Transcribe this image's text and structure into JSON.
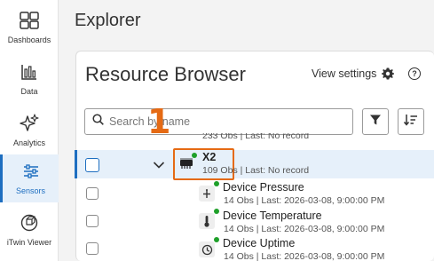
{
  "sidebar": {
    "items": [
      {
        "label": "Dashboards",
        "icon": "dashboards-icon"
      },
      {
        "label": "Data",
        "icon": "data-icon"
      },
      {
        "label": "Analytics",
        "icon": "analytics-icon"
      },
      {
        "label": "Sensors",
        "icon": "sensors-icon",
        "active": true
      },
      {
        "label": "iTwin Viewer",
        "icon": "itwin-viewer-icon"
      }
    ]
  },
  "page": {
    "title": "Explorer"
  },
  "panel": {
    "title": "Resource Browser",
    "view_settings_label": "View settings",
    "help_label": "?"
  },
  "search": {
    "placeholder": "Search by name"
  },
  "step_marker": "1",
  "tree": {
    "partial_row_meta": "233 Obs | Last: No record",
    "selected_node": {
      "name": "X2",
      "meta": "109 Obs | Last: No record"
    },
    "children": [
      {
        "name": "Device Pressure",
        "meta": "14 Obs | Last: 2026-03-08, 9:00:00 PM",
        "icon": "pressure-icon"
      },
      {
        "name": "Device Temperature",
        "meta": "14 Obs | Last: 2026-03-08, 9:00:00 PM",
        "icon": "thermometer-icon"
      },
      {
        "name": "Device Uptime",
        "meta": "14 Obs | Last: 2026-03-08, 9:00:00 PM",
        "icon": "uptime-icon"
      }
    ]
  },
  "colors": {
    "accent": "#1d6ec0",
    "highlight": "#e56a14",
    "status_online": "#1fa02a",
    "selected_row": "#e6f0fa"
  }
}
